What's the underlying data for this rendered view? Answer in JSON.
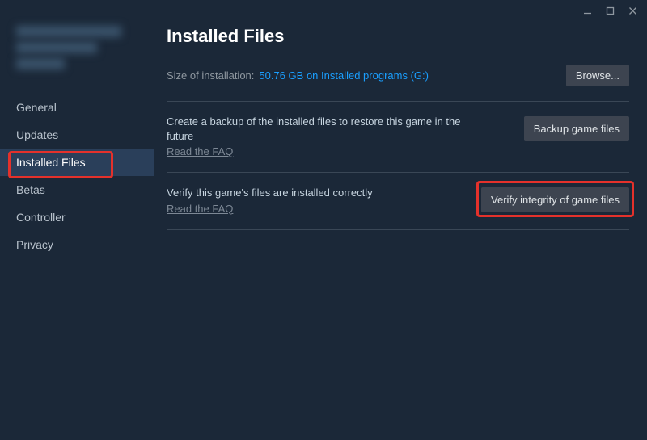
{
  "sidebar": {
    "items": [
      {
        "label": "General"
      },
      {
        "label": "Updates"
      },
      {
        "label": "Installed Files"
      },
      {
        "label": "Betas"
      },
      {
        "label": "Controller"
      },
      {
        "label": "Privacy"
      }
    ]
  },
  "main": {
    "title": "Installed Files",
    "size_label": "Size of installation:",
    "size_value": "50.76 GB on Installed programs (G:)",
    "browse_label": "Browse...",
    "backup": {
      "desc": "Create a backup of the installed files to restore this game in the future",
      "faq": "Read the FAQ",
      "button": "Backup game files"
    },
    "verify": {
      "desc": "Verify this game's files are installed correctly",
      "faq": "Read the FAQ",
      "button": "Verify integrity of game files"
    }
  }
}
